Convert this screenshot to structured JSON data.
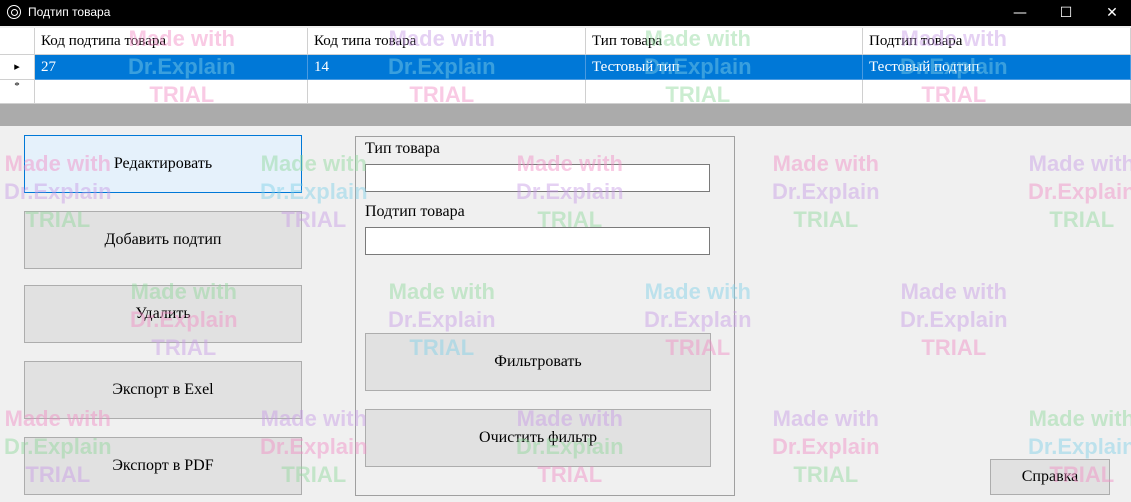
{
  "window": {
    "title": "Подтип товара",
    "minimize": "—",
    "maximize": "☐",
    "close": "✕"
  },
  "grid": {
    "columns": [
      "Код подтипа товара",
      "Код типа товара",
      "Тип товара",
      "Подтип товара"
    ],
    "rows": [
      {
        "indicator": "▸",
        "cells": [
          "27",
          "14",
          "Тестовый тип",
          "Тестовый подтип"
        ]
      }
    ],
    "new_row_indicator": "*"
  },
  "actions": {
    "edit": "Редактировать",
    "add": "Добавить подтип",
    "delete": "Удалить",
    "export_excel": "Экспорт в Exel",
    "export_pdf": "Экспорт в PDF"
  },
  "filter": {
    "type_label": "Тип товара",
    "type_value": "",
    "subtype_label": "Подтип товара",
    "subtype_value": "",
    "apply": "Фильтровать",
    "clear": "Очистить фильтр"
  },
  "help": "Справка",
  "watermark": {
    "line1": "Made with",
    "line2": "Dr.Explain",
    "line3": "TRIAL"
  },
  "colors": {
    "selection": "#0078d7",
    "titlebar": "#000000",
    "background": "#f0f0f0"
  }
}
